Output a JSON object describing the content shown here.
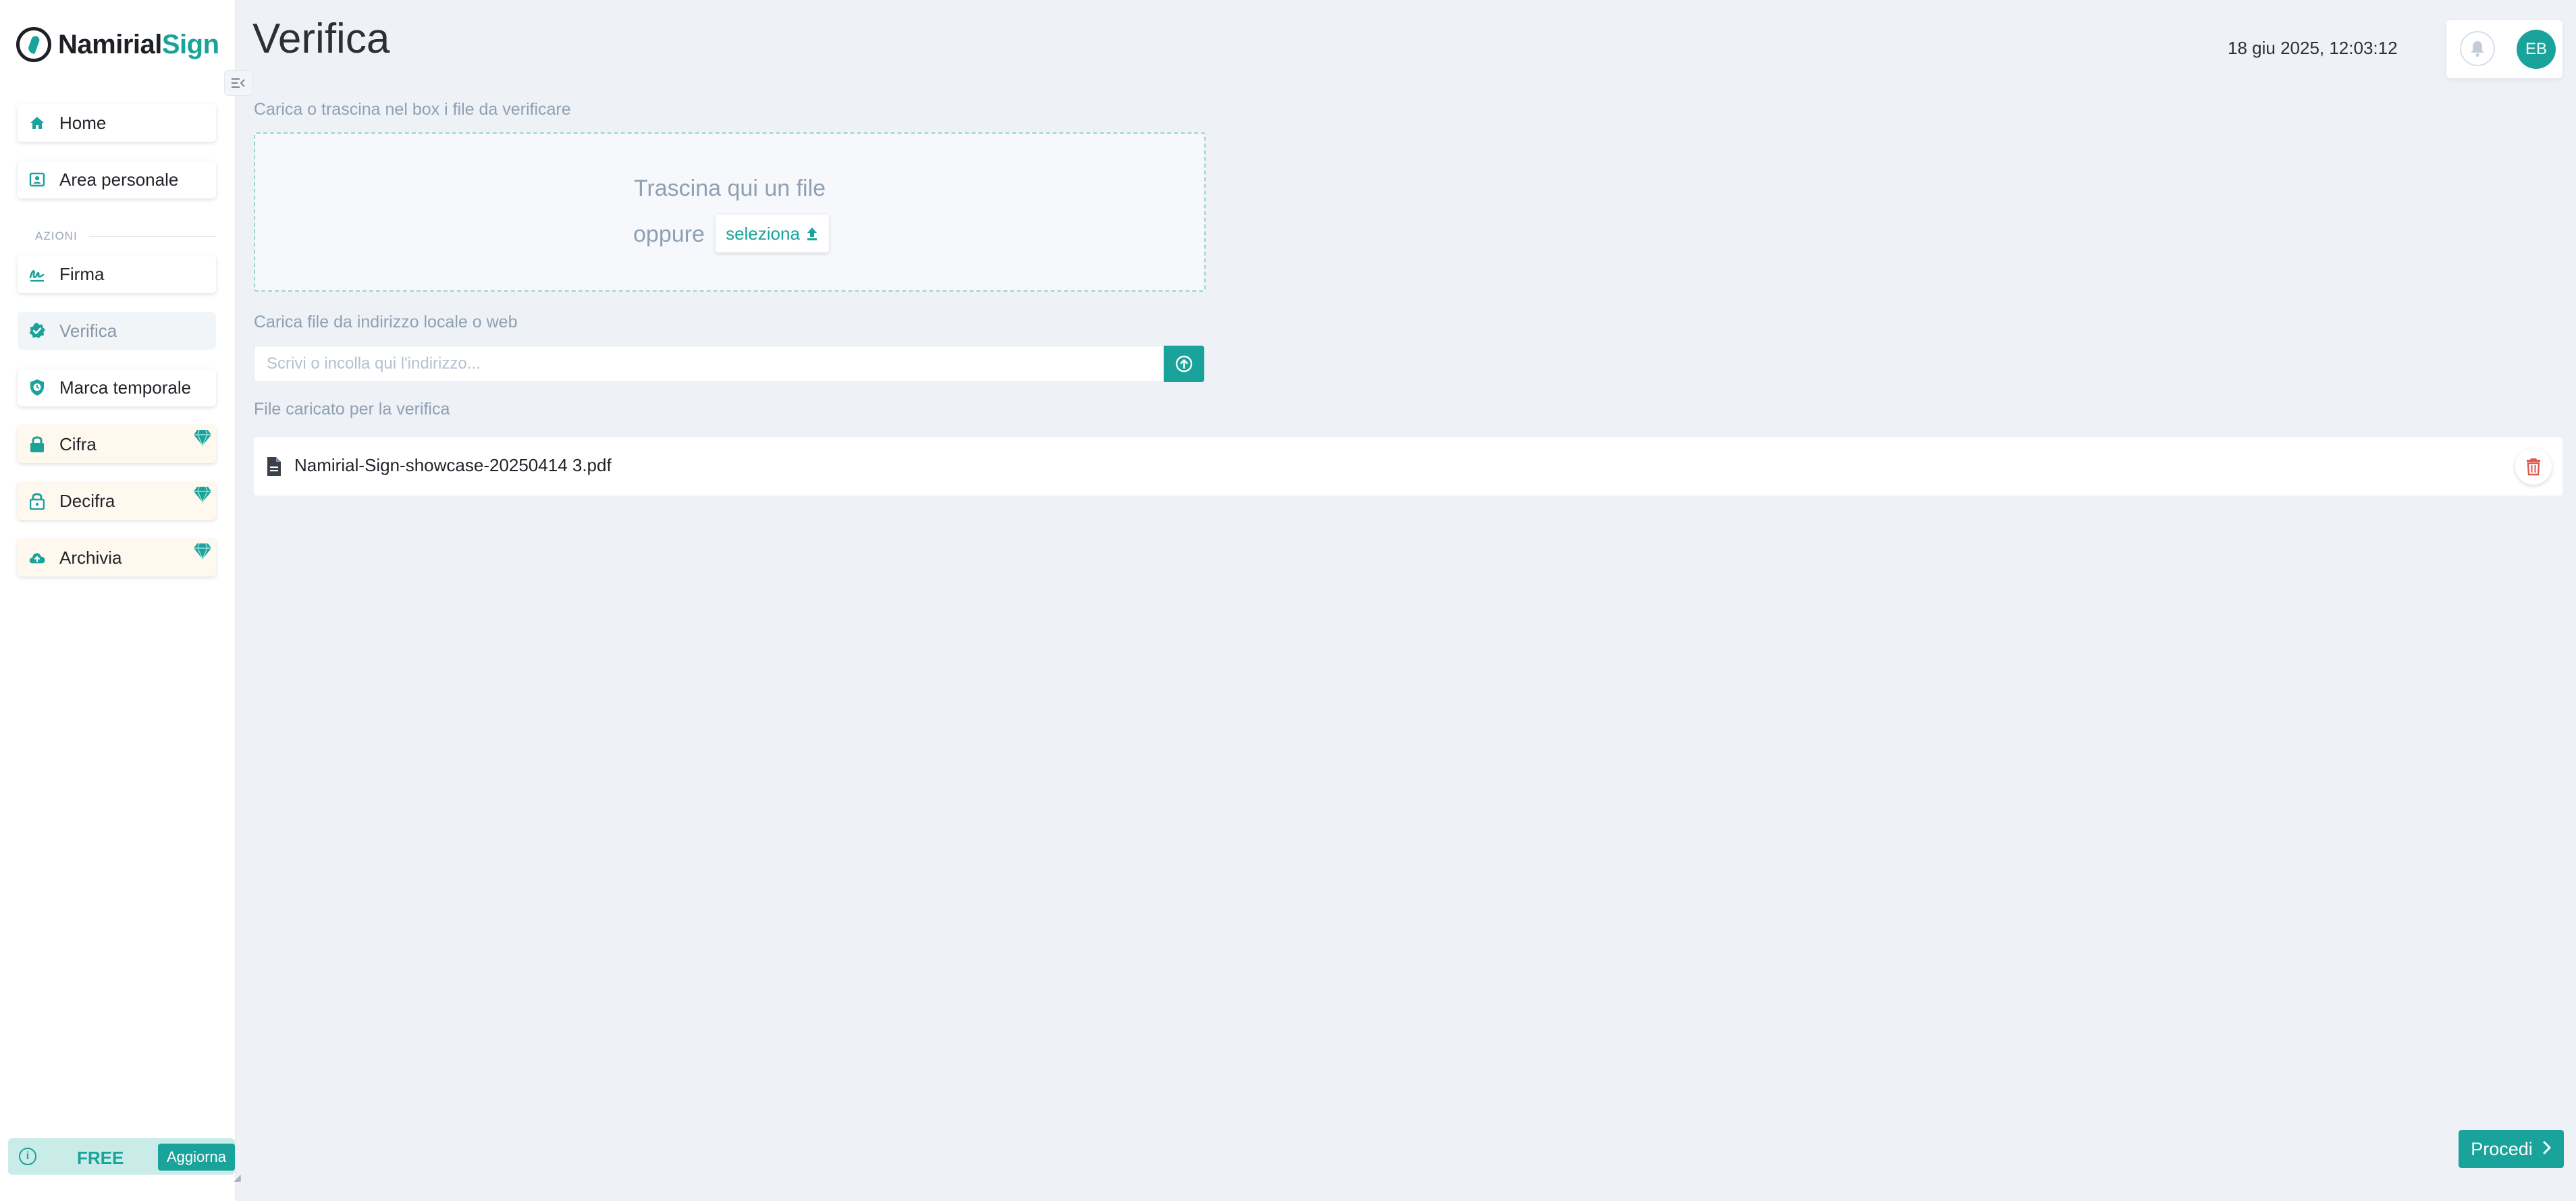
{
  "app": {
    "logo_part1": "Namirial",
    "logo_part2": "Sign",
    "collapse_icon": "sidebar-collapse-icon"
  },
  "sidebar": {
    "items_top": [
      {
        "label": "Home",
        "icon": "home-icon"
      },
      {
        "label": "Area personale",
        "icon": "id-card-icon"
      }
    ],
    "section_label": "AZIONI",
    "items_actions": [
      {
        "label": "Firma",
        "icon": "signature-icon"
      },
      {
        "label": "Verifica",
        "icon": "badge-check-icon",
        "active": true
      },
      {
        "label": "Marca temporale",
        "icon": "shield-icon"
      },
      {
        "label": "Cifra",
        "icon": "lock-icon",
        "premium": true
      },
      {
        "label": "Decifra",
        "icon": "unlock-icon",
        "premium": true
      },
      {
        "label": "Archivia",
        "icon": "cloud-upload-icon",
        "premium": true
      }
    ],
    "plan": {
      "info_icon": "i",
      "name": "FREE",
      "upgrade_label": "Aggiorna"
    }
  },
  "header": {
    "title": "Verifica",
    "datetime": "18 giu 2025, 12:03:12",
    "avatar_initials": "EB"
  },
  "upload": {
    "label": "Carica o trascina nel box i file da verificare",
    "drop_text": "Trascina qui un file",
    "or_text": "oppure",
    "select_label": "seleziona"
  },
  "url_upload": {
    "label": "Carica file da indirizzo locale o web",
    "placeholder": "Scrivi o incolla qui l'indirizzo..."
  },
  "uploaded": {
    "label": "File caricato per la verifica",
    "file_name": "Namirial-Sign-showcase-20250414 3.pdf"
  },
  "footer": {
    "proceed_label": "Procedi"
  },
  "colors": {
    "accent": "#1aa39a",
    "background": "#eef2f7",
    "premium_bg": "#fff8ee",
    "delete": "#e2574c"
  }
}
